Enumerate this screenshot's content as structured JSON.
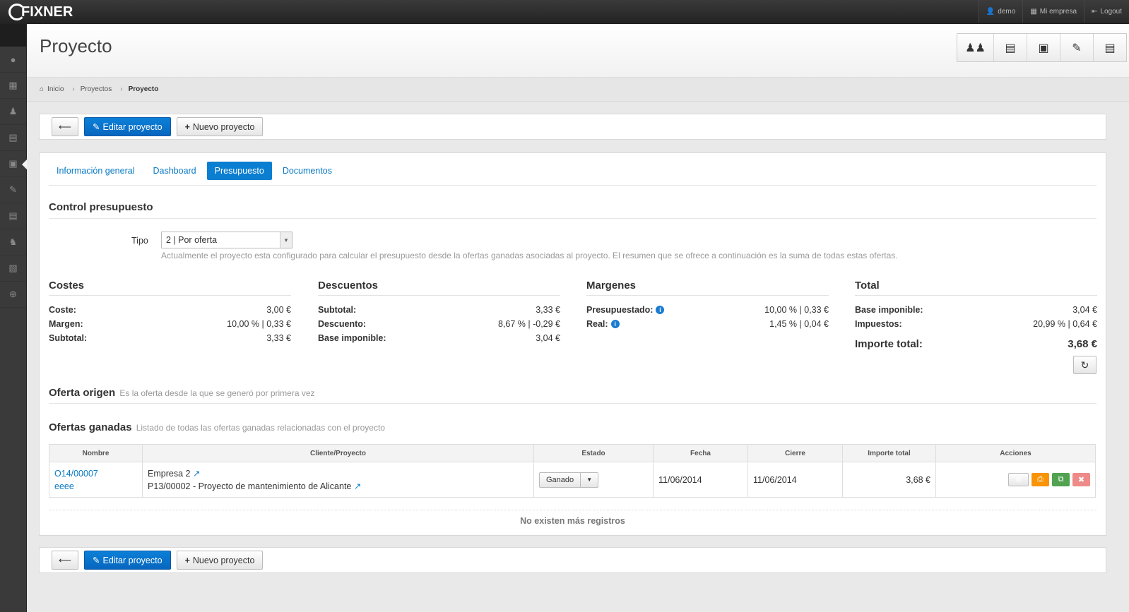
{
  "topbar": {
    "logo": "FIXNER",
    "user_menu": [
      {
        "label": "demo",
        "icon": "user-icon"
      },
      {
        "label": "Mi empresa",
        "icon": "building-icon"
      },
      {
        "label": "Logout",
        "icon": "logout-icon"
      }
    ]
  },
  "sidebar": {
    "items": [
      {
        "icon": "dashboard-icon"
      },
      {
        "icon": "calendar-icon"
      },
      {
        "icon": "users-icon"
      },
      {
        "icon": "documents-icon"
      },
      {
        "icon": "briefcase-icon",
        "active": true
      },
      {
        "icon": "edit-icon"
      },
      {
        "icon": "card-icon"
      },
      {
        "icon": "sitemap-icon"
      },
      {
        "icon": "archive-icon"
      },
      {
        "icon": "collapse-icon"
      }
    ]
  },
  "header": {
    "title": "Proyecto",
    "buttons": [
      "users-icon",
      "documents-icon",
      "briefcase-icon",
      "edit-icon",
      "card-icon"
    ]
  },
  "breadcrumb": {
    "items": [
      "Inicio",
      "Proyectos",
      "Proyecto"
    ]
  },
  "actions": {
    "back_label": "🡐",
    "edit_label": "Editar proyecto",
    "new_label": "Nuevo proyecto"
  },
  "tabs": [
    {
      "label": "Información general",
      "active": false
    },
    {
      "label": "Dashboard",
      "active": false
    },
    {
      "label": "Presupuesto",
      "active": true
    },
    {
      "label": "Documentos",
      "active": false
    }
  ],
  "control": {
    "title": "Control presupuesto",
    "tipo_label": "Tipo",
    "tipo_value": "2 | Por oferta",
    "help": "Actualmente el proyecto esta configurado para calcular el presupuesto desde la ofertas ganadas asociadas al proyecto. El resumen que se ofrece a continuación es la suma de todas estas ofertas."
  },
  "summary": {
    "costes": {
      "title": "Costes",
      "rows": [
        {
          "k": "Coste:",
          "v": "3,00 €"
        },
        {
          "k": "Margen:",
          "v": "10,00 % | 0,33 €"
        },
        {
          "k": "Subtotal:",
          "v": "3,33 €"
        }
      ]
    },
    "descuentos": {
      "title": "Descuentos",
      "rows": [
        {
          "k": "Subtotal:",
          "v": "3,33 €"
        },
        {
          "k": "Descuento:",
          "v": "8,67 % | -0,29 €"
        },
        {
          "k": "Base imponible:",
          "v": "3,04 €"
        }
      ]
    },
    "margenes": {
      "title": "Margenes",
      "rows": [
        {
          "k": "Presupuestado:",
          "v": "10,00 % | 0,33 €"
        },
        {
          "k": "Real:",
          "v": "1,45 % | 0,04 €"
        }
      ]
    },
    "total": {
      "title": "Total",
      "rows": [
        {
          "k": "Base imponible:",
          "v": "3,04 €"
        },
        {
          "k": "Impuestos:",
          "v": "20,99 % | 0,64 €"
        }
      ],
      "importe_label": "Importe total:",
      "importe_value": "3,68 €"
    }
  },
  "oferta_origen": {
    "title": "Oferta origen",
    "subtitle": "Es la oferta desde la que se generó por primera vez"
  },
  "ofertas_ganadas": {
    "title": "Ofertas ganadas",
    "subtitle": "Listado de todas las ofertas ganadas relacionadas con el proyecto",
    "columns": [
      "Nombre",
      "Cliente/Proyecto",
      "Estado",
      "Fecha",
      "Cierre",
      "Importe total",
      "Acciones"
    ],
    "row": {
      "codigo": "O14/00007",
      "nombre": "eeee",
      "cliente": "Empresa 2",
      "proyecto": "P13/00002 - Proyecto de mantenimiento de Alicante",
      "estado": "Ganado",
      "fecha": "11/06/2014",
      "cierre": "11/06/2014",
      "importe": "3,68 €"
    },
    "no_more": "No existen más registros"
  }
}
